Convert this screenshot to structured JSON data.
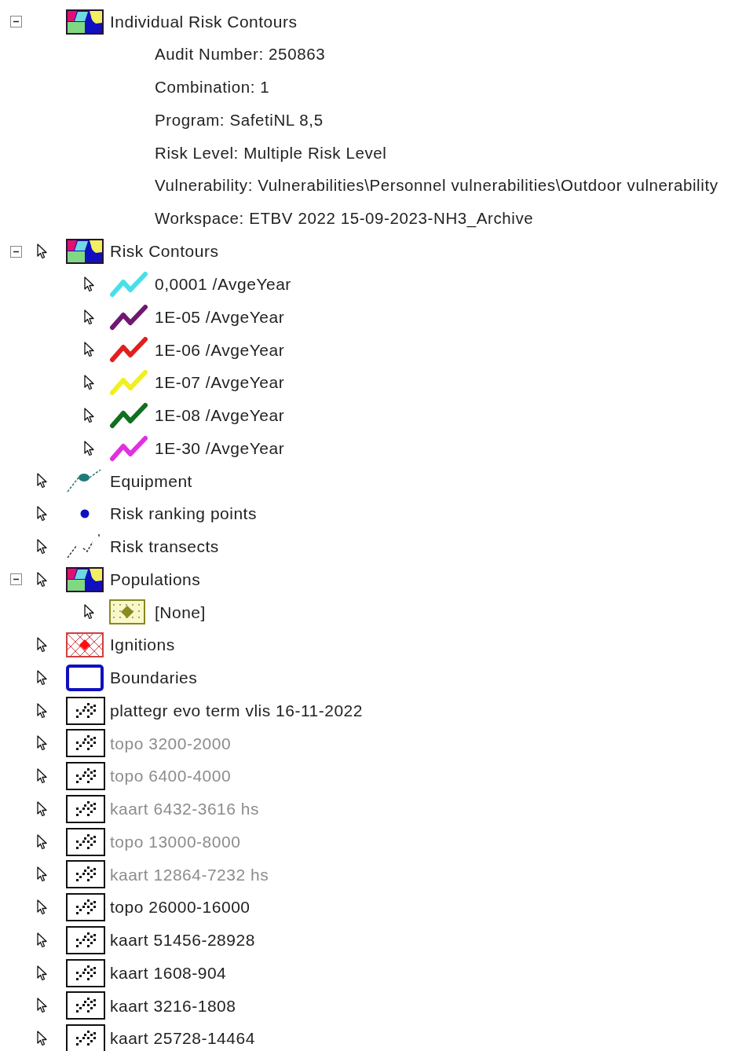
{
  "tree": [
    {
      "label": "Individual Risk Contours",
      "kind": "area",
      "selectable": false,
      "disabled": false,
      "expanded": true,
      "details": [
        "Audit Number: 250863",
        "Combination: 1",
        "Program: SafetiNL 8,5",
        "Risk Level: Multiple Risk Level",
        "Vulnerability: Vulnerabilities\\Personnel vulnerabilities\\Outdoor vulnerability",
        "Workspace: ETBV 2022 15-09-2023-NH3_Archive"
      ]
    },
    {
      "label": "Risk Contours",
      "kind": "area",
      "selectable": true,
      "disabled": false,
      "expanded": true,
      "children": [
        {
          "label": "0,0001 /AvgeYear",
          "kind": "line",
          "color": "#48e0e8"
        },
        {
          "label": "1E-05 /AvgeYear",
          "kind": "line",
          "color": "#701870"
        },
        {
          "label": "1E-06 /AvgeYear",
          "kind": "line",
          "color": "#e02020"
        },
        {
          "label": "1E-07 /AvgeYear",
          "kind": "line",
          "color": "#f0f020"
        },
        {
          "label": "1E-08 /AvgeYear",
          "kind": "line",
          "color": "#107020"
        },
        {
          "label": "1E-30 /AvgeYear",
          "kind": "line",
          "color": "#e030e0"
        }
      ]
    },
    {
      "label": "Equipment",
      "kind": "equipment",
      "selectable": true,
      "disabled": false
    },
    {
      "label": "Risk ranking points",
      "kind": "point",
      "selectable": true,
      "disabled": false
    },
    {
      "label": "Risk transects",
      "kind": "transect",
      "selectable": true,
      "disabled": false
    },
    {
      "label": "Populations",
      "kind": "area",
      "selectable": true,
      "disabled": false,
      "expanded": true,
      "children": [
        {
          "label": "[None]",
          "kind": "population"
        }
      ]
    },
    {
      "label": "Ignitions",
      "kind": "ignition",
      "selectable": true,
      "disabled": false
    },
    {
      "label": "Boundaries",
      "kind": "boundary",
      "selectable": true,
      "disabled": false
    },
    {
      "label": "plattegr evo term vlis 16-11-2022",
      "kind": "map",
      "selectable": true,
      "disabled": false
    },
    {
      "label": "topo 3200-2000",
      "kind": "map",
      "selectable": true,
      "disabled": true
    },
    {
      "label": "topo 6400-4000",
      "kind": "map",
      "selectable": true,
      "disabled": true
    },
    {
      "label": "kaart 6432-3616 hs",
      "kind": "map",
      "selectable": true,
      "disabled": true
    },
    {
      "label": "topo 13000-8000",
      "kind": "map",
      "selectable": true,
      "disabled": true
    },
    {
      "label": "kaart 12864-7232 hs",
      "kind": "map",
      "selectable": true,
      "disabled": true
    },
    {
      "label": "topo 26000-16000",
      "kind": "map",
      "selectable": true,
      "disabled": false
    },
    {
      "label": "kaart 51456-28928",
      "kind": "map",
      "selectable": true,
      "disabled": false
    },
    {
      "label": "kaart 1608-904",
      "kind": "map",
      "selectable": true,
      "disabled": false
    },
    {
      "label": "kaart 3216-1808",
      "kind": "map",
      "selectable": true,
      "disabled": false
    },
    {
      "label": "kaart 25728-14464",
      "kind": "map",
      "selectable": true,
      "disabled": false
    }
  ]
}
